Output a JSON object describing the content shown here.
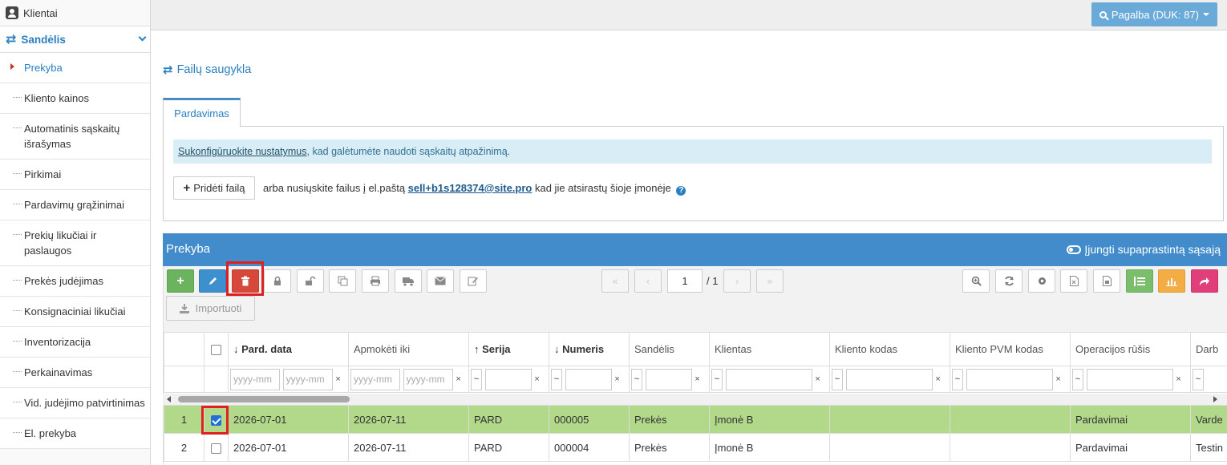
{
  "sidebar": {
    "top_item": "Klientai",
    "group": "Sandėlis",
    "items": [
      {
        "label": "Prekyba"
      },
      {
        "label": "Kliento kainos"
      },
      {
        "label": "Automatinis sąskaitų išrašymas"
      },
      {
        "label": "Pirkimai"
      },
      {
        "label": "Pardavimų grąžinimai"
      },
      {
        "label": "Prekių likučiai ir paslaugos"
      },
      {
        "label": "Prekės judėjimas"
      },
      {
        "label": "Konsignaciniai likučiai"
      },
      {
        "label": "Inventorizacija"
      },
      {
        "label": "Perkainavimas"
      },
      {
        "label": "Vid. judėjimo patvirtinimas"
      },
      {
        "label": "El. prekyba"
      }
    ]
  },
  "topbar": {
    "help_label": "Pagalba (DUK: 87)"
  },
  "page": {
    "heading": "Failų saugykla",
    "tab": "Pardavimas",
    "alert_link": "Sukonfigūruokite nustatymus",
    "alert_text": ", kad galėtumėte naudoti sąskaitų atpažinimą.",
    "add_file": "Pridėti failą",
    "email_prefix": "arba nusiųskite failus į el.paštą",
    "email": "sell+b1s128374@site.pro",
    "email_suffix": "kad jie atsirastų šioje įmonėje"
  },
  "grid": {
    "title": "Prekyba",
    "simple_toggle": "Įjungti supaprastintą sąsają",
    "import_label": "Importuoti",
    "page_current": "1",
    "page_total": "/ 1",
    "date_placeholder": "yyyy-mm",
    "columns": [
      "Pard. data",
      "Apmokėti iki",
      "Serija",
      "Numeris",
      "Sandėlis",
      "Klientas",
      "Kliento kodas",
      "Kliento PVM kodas",
      "Operacijos rūšis",
      "Darb"
    ],
    "rows": [
      {
        "n": "1",
        "selected": true,
        "cells": [
          "2026-07-01",
          "2026-07-11",
          "PARD",
          "000005",
          "Prekės",
          "Įmonė B",
          "",
          "",
          "Pardavimai",
          "Varde"
        ]
      },
      {
        "n": "2",
        "selected": false,
        "cells": [
          "2026-07-01",
          "2026-07-11",
          "PARD",
          "000004",
          "Prekės",
          "Įmonė B",
          "",
          "",
          "Pardavimai",
          "Testin"
        ]
      }
    ]
  },
  "colors": {
    "accent": "#2a7fc1",
    "grid_header": "#438ccb",
    "selected_row": "#b2d98a",
    "highlight": "#e02020"
  }
}
